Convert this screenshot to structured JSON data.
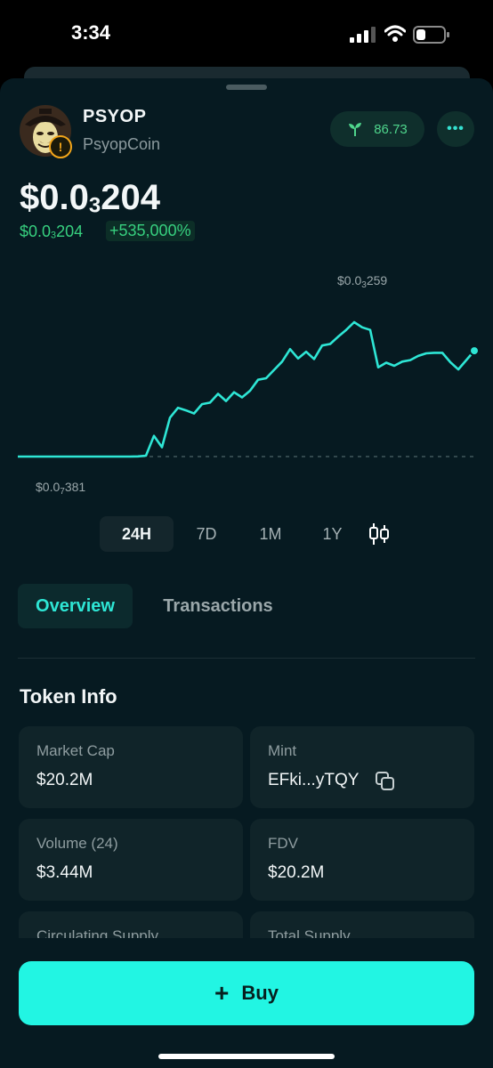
{
  "status": {
    "time": "3:34"
  },
  "token": {
    "symbol": "PSYOP",
    "name": "PsyopCoin",
    "warning_glyph": "!",
    "score": "86.73",
    "more_glyph": "•••",
    "price_a": "$0.0",
    "price_sub": "3",
    "price_b": "204",
    "change_a": "$0.0",
    "change_sub": "3",
    "change_b": "204",
    "change_pct": "+535,000%"
  },
  "chart_data": {
    "type": "line",
    "x": [
      0,
      1,
      2,
      3,
      4,
      5,
      6,
      7,
      8,
      9,
      10,
      11,
      12,
      13,
      14,
      15,
      16,
      17,
      18,
      19,
      20,
      21,
      22,
      23,
      24,
      25,
      26,
      27,
      28,
      29,
      30,
      31,
      32,
      33,
      34,
      35,
      36,
      37,
      38,
      39,
      40,
      41,
      42,
      43,
      44,
      45,
      46,
      47,
      48,
      49,
      50,
      51,
      52,
      53,
      54,
      55,
      56,
      57
    ],
    "values": [
      3.81e-08,
      3.81e-08,
      3.81e-08,
      3.81e-08,
      3.81e-08,
      3.81e-08,
      3.81e-08,
      3.81e-08,
      3.81e-08,
      3.81e-08,
      3.81e-08,
      3.81e-08,
      3.81e-08,
      3.81e-08,
      3.81e-08,
      3.5e-07,
      1.7e-06,
      4e-05,
      1.8e-05,
      7.5e-05,
      9.4e-05,
      8.9e-05,
      8.3e-05,
      0.000101,
      0.000104,
      0.000121,
      0.000107,
      0.000124,
      0.000114,
      0.000127,
      0.000148,
      0.000151,
      0.000167,
      0.000183,
      0.000207,
      0.000189,
      0.000202,
      0.000188,
      0.000214,
      0.000217,
      0.000231,
      0.000244,
      0.000259,
      0.000249,
      0.000244,
      0.000172,
      0.000181,
      0.000175,
      0.000183,
      0.000186,
      0.000194,
      0.000199,
      0.0002,
      0.0002,
      0.000182,
      0.000168,
      0.000186,
      0.000204
    ],
    "max_label_a": "$0.0",
    "max_label_sub": "3",
    "max_label_b": "259",
    "min_label_a": "$0.0",
    "min_label_sub": "7",
    "min_label_b": "381",
    "line_color": "#2ee6d5"
  },
  "ranges": [
    {
      "label": "24H",
      "active": true
    },
    {
      "label": "7D",
      "active": false
    },
    {
      "label": "1M",
      "active": false
    },
    {
      "label": "1Y",
      "active": false
    }
  ],
  "tabs": {
    "overview": "Overview",
    "transactions": "Transactions"
  },
  "token_info": {
    "title": "Token Info",
    "market_cap_label": "Market Cap",
    "market_cap": "$20.2M",
    "mint_label": "Mint",
    "mint": "EFki...yTQY",
    "volume_label": "Volume (24)",
    "volume": "$3.44M",
    "fdv_label": "FDV",
    "fdv": "$20.2M",
    "circ_label": "Circulating Supply",
    "total_label": "Total Supply"
  },
  "buy": {
    "label": "Buy",
    "plus": "+"
  },
  "colors": {
    "accent": "#22f5e3",
    "positive": "#37d07f",
    "warning": "#f2a51a",
    "background": "#061a21"
  }
}
